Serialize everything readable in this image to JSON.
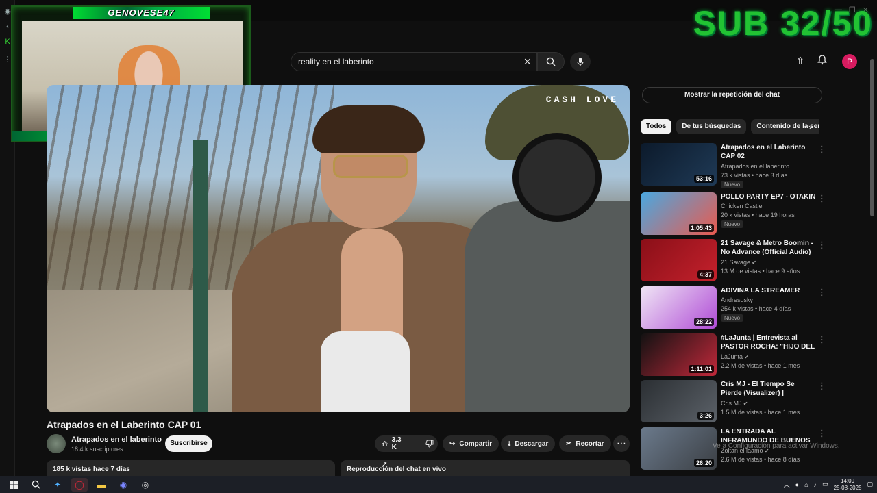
{
  "overlay": {
    "streamer": "GENOVESE47",
    "sub_counter": "SUB 32/50"
  },
  "header": {
    "search_value": "reality en el laberinto",
    "avatar_letter": "P"
  },
  "video": {
    "watermark": "CASH LOVE"
  },
  "below_video": {
    "title": "Atrapados en el Laberinto CAP 01",
    "channel": "Atrapados en el laberinto",
    "subscribers": "18.4 k suscriptores",
    "subscribe_label": "Suscribirse",
    "likes": "3.3 K",
    "share_label": "Compartir",
    "download_label": "Descargar",
    "clip_label": "Recortar",
    "views_date": "185 k vistas  hace 7 días",
    "chat_replay": "Reproducción del chat en vivo"
  },
  "sidebar": {
    "chat_button": "Mostrar la repetición del chat",
    "chips": [
      "Todos",
      "De tus búsquedas",
      "Contenido de la ser"
    ],
    "recommendations": [
      {
        "title": "Atrapados en el Laberinto CAP 02",
        "channel": "Atrapados en el laberinto",
        "meta": "73 k vistas  •  hace 3 días",
        "duration": "53:16",
        "badge": "Nuevo",
        "verified": false,
        "colors": [
          "#0c1a2b",
          "#1f3a56"
        ]
      },
      {
        "title": "POLLO PARTY EP7 - OTAKIN",
        "channel": "Chicken Castle",
        "meta": "20 k vistas  •  hace 19 horas",
        "duration": "1:05:43",
        "badge": "Nuevo",
        "verified": false,
        "colors": [
          "#4aa8e0",
          "#e95a4f"
        ]
      },
      {
        "title": "21 Savage & Metro Boomin - No Advance (Official Audio)",
        "channel": "21 Savage",
        "meta": "13 M de vistas  •  hace 9 años",
        "duration": "4:37",
        "badge": "",
        "verified": true,
        "colors": [
          "#8a0f18",
          "#c4212c"
        ]
      },
      {
        "title": "ADIVINA LA STREAMER",
        "channel": "Andresosky",
        "meta": "254 k vistas  •  hace 4 días",
        "duration": "28:22",
        "badge": "Nuevo",
        "verified": false,
        "colors": [
          "#f0e6f5",
          "#b04cd6"
        ]
      },
      {
        "title": "#LaJunta | Entrevista al PASTOR ROCHA: \"HIJO DEL J...",
        "channel": "LaJunta",
        "meta": "2.2 M de vistas  •  hace 1 mes",
        "duration": "1:11:01",
        "badge": "",
        "verified": true,
        "colors": [
          "#121212",
          "#c0283a"
        ]
      },
      {
        "title": "Cris MJ - El Tiempo Se Pierde (Visualizer) | Apocalipsis",
        "channel": "Cris MJ",
        "meta": "1.5 M de vistas  •  hace 1 mes",
        "duration": "3:26",
        "badge": "",
        "verified": true,
        "colors": [
          "#2b2f33",
          "#5b6168"
        ]
      },
      {
        "title": "LA ENTRADA AL INFRAMUNDO DE BUENOS AIRES - ¡Aquí NO ...",
        "channel": "Zoltan el laamo",
        "meta": "2.6 M de vistas  •  hace 8 días",
        "duration": "26:20",
        "badge": "",
        "verified": true,
        "colors": [
          "#6b7a8c",
          "#3b3f44"
        ]
      }
    ]
  },
  "watermark_windows": "Ve a Configuración para activar Windows.",
  "taskbar": {
    "time": "14:09",
    "date": "25-08-2025"
  }
}
